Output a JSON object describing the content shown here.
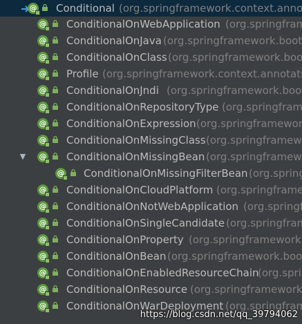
{
  "colors": {
    "background": "#3c3f41",
    "selected_row": "#0d293e",
    "annotation_icon": "#5c9a3c",
    "name_text": "#bbbbbb",
    "package_text": "#808080"
  },
  "icons": {
    "annotation": "annotation-icon",
    "lock": "lock-icon",
    "expand_collapse": "triangle-down-icon",
    "current_node": "arrow-right-icon"
  },
  "tree": {
    "icon_letter": "@",
    "collapse_glyph": "▼",
    "root": {
      "name": "Conditional",
      "package": "(org.springframework.context.annotation)"
    },
    "children": [
      {
        "name": "ConditionalOnWebApplication",
        "package": "(org.springframework.boot.autoconfigure.condition)"
      },
      {
        "name": "ConditionalOnJava",
        "package": "(org.springframework.boot.autoconfigure.condition)"
      },
      {
        "name": "ConditionalOnClass",
        "package": "(org.springframework.boot.autoconfigure.condition)"
      },
      {
        "name": "Profile",
        "package": "(org.springframework.context.annotation)"
      },
      {
        "name": "ConditionalOnJndi",
        "package": "(org.springframework.boot.autoconfigure.condition)"
      },
      {
        "name": "ConditionalOnRepositoryType",
        "package": "(org.springframework.boot.autoconfigure.data)"
      },
      {
        "name": "ConditionalOnExpression",
        "package": "(org.springframework.boot.autoconfigure.condition)"
      },
      {
        "name": "ConditionalOnMissingClass",
        "package": "(org.springframework.boot.autoconfigure.condition)"
      },
      {
        "name": "ConditionalOnMissingBean",
        "package": "(org.springframework.boot.autoconfigure.condition)"
      },
      {
        "name": "ConditionalOnMissingFilterBean",
        "package": "(org.springframework.boot.autoconfigure.web.servlet)"
      },
      {
        "name": "ConditionalOnCloudPlatform",
        "package": "(org.springframework.boot.autoconfigure.condition)"
      },
      {
        "name": "ConditionalOnNotWebApplication",
        "package": "(org.springframework.boot.autoconfigure.condition)"
      },
      {
        "name": "ConditionalOnSingleCandidate",
        "package": "(org.springframework.boot.autoconfigure.condition)"
      },
      {
        "name": "ConditionalOnProperty",
        "package": "(org.springframework.boot.autoconfigure.condition)"
      },
      {
        "name": "ConditionalOnBean",
        "package": "(org.springframework.boot.autoconfigure.condition)"
      },
      {
        "name": "ConditionalOnEnabledResourceChain",
        "package": "(org.springframework.boot.autoconfigure.web)"
      },
      {
        "name": "ConditionalOnResource",
        "package": "(org.springframework.boot.autoconfigure.condition)"
      },
      {
        "name": "ConditionalOnWarDeployment",
        "package": "(org.springframework.boot.autoconfigure.condition)"
      }
    ]
  },
  "watermark": "https://blog.csdn.net/qq_39794062"
}
